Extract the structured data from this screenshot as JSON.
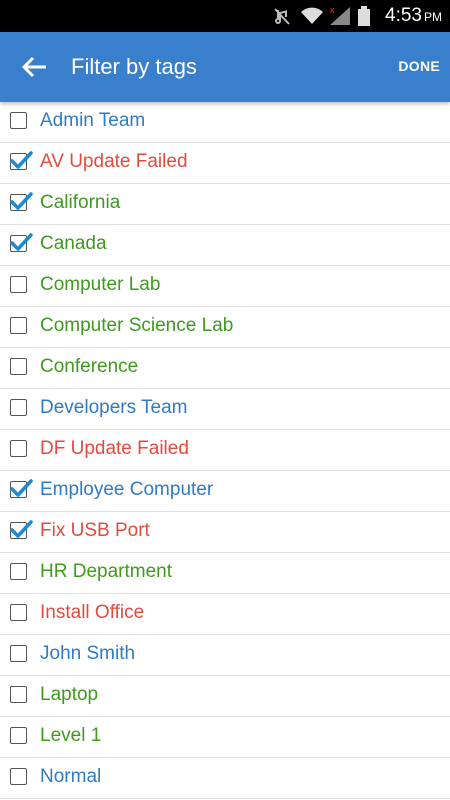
{
  "status_bar": {
    "time": "4:53",
    "ampm": "PM",
    "icons": [
      "mute-icon",
      "wifi-icon",
      "signal-icon",
      "battery-icon"
    ]
  },
  "app_bar": {
    "title": "Filter by tags",
    "done_label": "DONE",
    "color": "#3a7fcc"
  },
  "colors": {
    "blue": "#2f7bc4",
    "green": "#3f9a1e",
    "red": "#e64a3c",
    "check": "#1a8ad4"
  },
  "tags": [
    {
      "label": "Admin Team",
      "color": "blue",
      "checked": false
    },
    {
      "label": "AV Update Failed",
      "color": "red",
      "checked": true
    },
    {
      "label": "California",
      "color": "green",
      "checked": true
    },
    {
      "label": "Canada",
      "color": "green",
      "checked": true
    },
    {
      "label": "Computer Lab",
      "color": "green",
      "checked": false
    },
    {
      "label": "Computer Science Lab",
      "color": "green",
      "checked": false
    },
    {
      "label": "Conference",
      "color": "green",
      "checked": false
    },
    {
      "label": "Developers Team",
      "color": "blue",
      "checked": false
    },
    {
      "label": "DF Update Failed",
      "color": "red",
      "checked": false
    },
    {
      "label": "Employee Computer",
      "color": "blue",
      "checked": true
    },
    {
      "label": "Fix USB Port",
      "color": "red",
      "checked": true
    },
    {
      "label": "HR Department",
      "color": "green",
      "checked": false
    },
    {
      "label": "Install Office",
      "color": "red",
      "checked": false
    },
    {
      "label": "John Smith",
      "color": "blue",
      "checked": false
    },
    {
      "label": "Laptop",
      "color": "green",
      "checked": false
    },
    {
      "label": "Level 1",
      "color": "green",
      "checked": false
    },
    {
      "label": "Normal",
      "color": "blue",
      "checked": false
    }
  ]
}
